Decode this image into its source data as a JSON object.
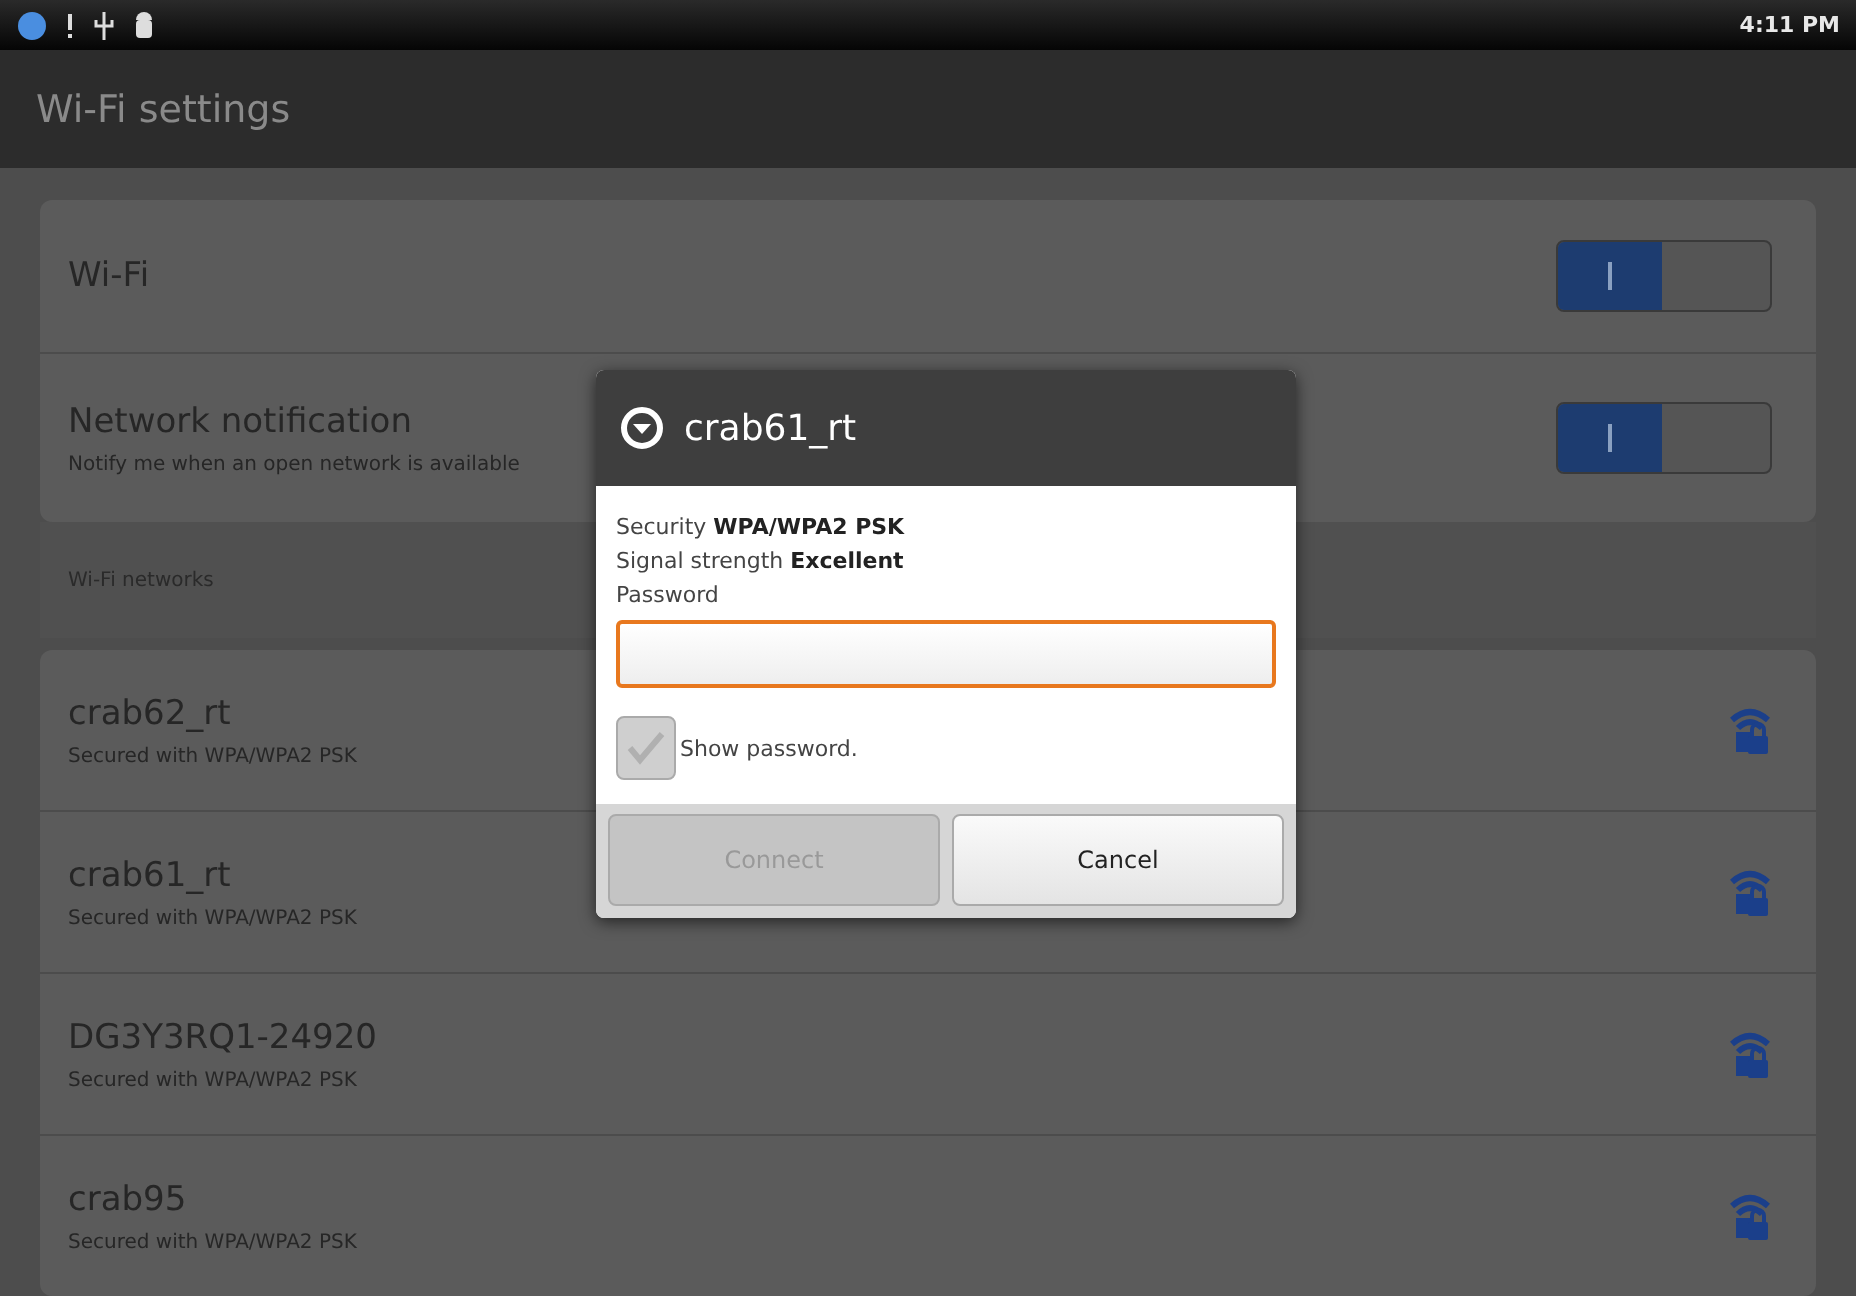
{
  "status_bar": {
    "time": "4:11 PM"
  },
  "title_bar": {
    "title": "Wi-Fi settings"
  },
  "settings": [
    {
      "label": "Wi-Fi",
      "on": true
    },
    {
      "label": "Network notification",
      "summary": "Notify me when an open network is available",
      "on": true
    }
  ],
  "section_header": "Wi-Fi networks",
  "networks": [
    {
      "name": "crab62_rt",
      "summary": "Secured with WPA/WPA2 PSK"
    },
    {
      "name": "crab61_rt",
      "summary": "Secured with WPA/WPA2 PSK"
    },
    {
      "name": "DG3Y3RQ1-24920",
      "summary": "Secured with WPA/WPA2 PSK"
    },
    {
      "name": "crab95",
      "summary": "Secured with WPA/WPA2 PSK"
    }
  ],
  "dialog": {
    "title": "crab61_rt",
    "details": [
      {
        "label": "Security",
        "value": "WPA/WPA2 PSK"
      },
      {
        "label": "Signal strength",
        "value": "Excellent"
      }
    ],
    "password_label": "Password",
    "show_password": {
      "label": "Show password.",
      "checked": true
    },
    "buttons": [
      {
        "label": "Connect",
        "disabled": true
      },
      {
        "label": "Cancel",
        "disabled": false
      }
    ]
  }
}
